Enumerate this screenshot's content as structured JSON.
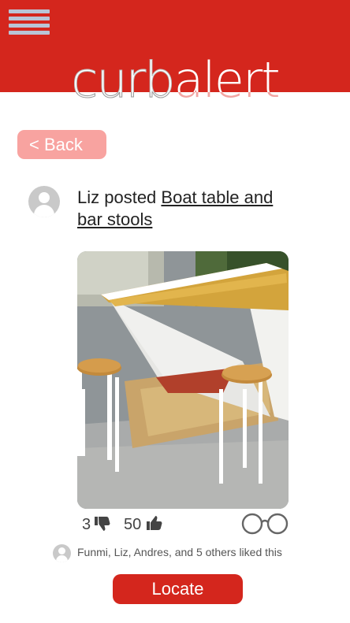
{
  "header": {
    "logo_part1": "curb",
    "logo_part2": "alert",
    "menu_icon": "hamburger-menu-icon",
    "bg_color": "#d4261d"
  },
  "back_button": {
    "label": "< Back"
  },
  "post": {
    "author": "Liz",
    "verb": " posted ",
    "item_title": "Boat table and bar stools",
    "photo_description_icon": "boat-table-photo"
  },
  "reactions": {
    "dislikes": "3",
    "likes": "50",
    "dislike_icon": "thumbs-down-icon",
    "like_icon": "thumbs-up-icon",
    "watch_icon": "glasses-icon"
  },
  "liked_by": {
    "text": "Funmi, Liz, Andres, and 5 others liked this"
  },
  "locate_button": {
    "label": "Locate"
  }
}
